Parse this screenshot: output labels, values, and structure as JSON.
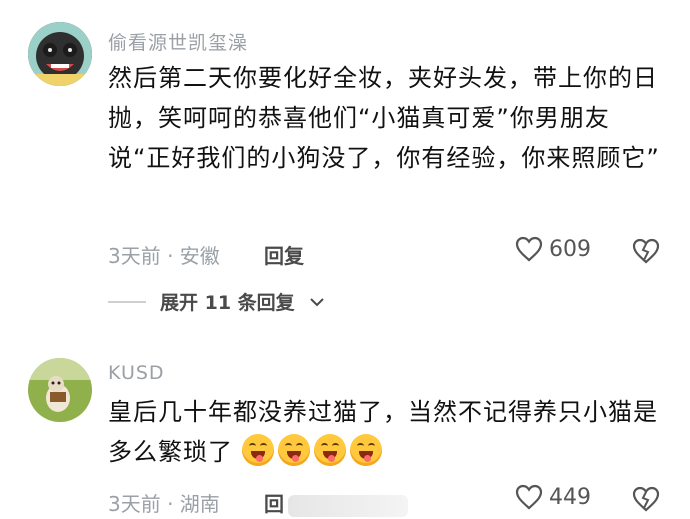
{
  "comments": [
    {
      "username": "偷看源世凯玺澡",
      "text": "然后第二天你要化好全妆，夹好头发，带上你的日抛，笑呵呵的恭喜他们“小猫真可爱”你男朋友说“正好我们的小狗没了，你有经验，你来照顾它”",
      "time_location": "3天前 · 安徽",
      "reply_label": "回复",
      "likes": "609",
      "expand_label": "展开 11 条回复"
    },
    {
      "username": "KUSD",
      "text": "皇后几十年都没养过猫了，当然不记得养只小猫是多么繁琐了",
      "emoji_count": 4,
      "time_location": "3天前 · 湖南",
      "reply_label": "回",
      "likes": "449"
    }
  ],
  "colors": {
    "meta_gray": "#9aa0a6",
    "body_text": "#111111",
    "emoji_yellow": "#ffc83d"
  },
  "icons": [
    "heart-outline-icon",
    "broken-heart-icon",
    "chevron-down-icon",
    "grinning-tongue-emoji"
  ]
}
